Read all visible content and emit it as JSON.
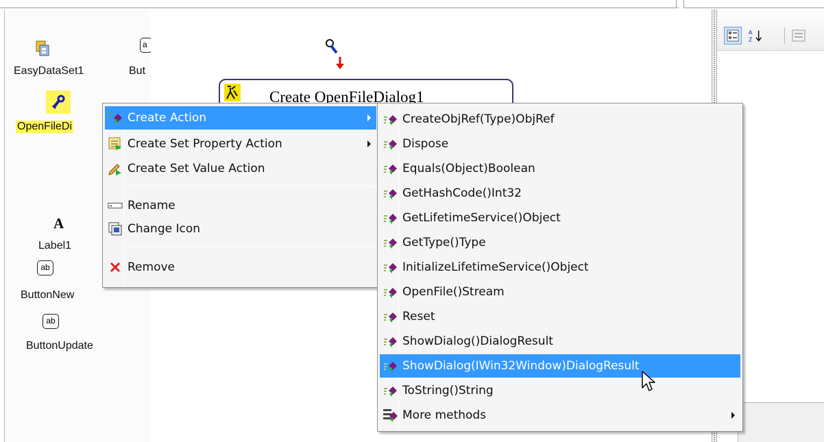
{
  "left_panel": {
    "components": [
      {
        "name": "EasyDataSet1"
      },
      {
        "name": "But"
      },
      {
        "name": "OpenFileDi"
      },
      {
        "name": "Label1"
      },
      {
        "name": "ButtonNew"
      },
      {
        "name": "ButtonUpdate"
      }
    ],
    "icons": {
      "label_glyph": "A",
      "button_glyph": "ab",
      "button_glyph_partial": "a"
    }
  },
  "canvas": {
    "action_title": "Create OpenFileDialog1"
  },
  "properties": {
    "toolbar": [
      {
        "icon": "categorized-icon",
        "active": true
      },
      {
        "icon": "sort-alphabetical-icon",
        "active": false
      },
      {
        "icon": "property-pages-icon",
        "active": false
      }
    ]
  },
  "context_menu": {
    "items": [
      {
        "label": "Create Action",
        "icon": "create-action-icon",
        "submenu": true,
        "selected": true
      },
      {
        "label": "Create Set Property Action",
        "icon": "set-property-icon",
        "submenu": true
      },
      {
        "label": "Create Set Value Action",
        "icon": "set-value-icon",
        "submenu": false
      },
      {
        "label": "Rename",
        "icon": "rename-icon",
        "submenu": false
      },
      {
        "label": "Change Icon",
        "icon": "change-icon-icon",
        "submenu": false
      },
      {
        "label": "Remove",
        "icon": "remove-icon",
        "submenu": false
      }
    ]
  },
  "submenu": {
    "items": [
      {
        "label": "CreateObjRef(Type)ObjRef"
      },
      {
        "label": "Dispose"
      },
      {
        "label": "Equals(Object)Boolean"
      },
      {
        "label": "GetHashCode()Int32"
      },
      {
        "label": "GetLifetimeService()Object"
      },
      {
        "label": "GetType()Type"
      },
      {
        "label": "InitializeLifetimeService()Object"
      },
      {
        "label": "OpenFile()Stream"
      },
      {
        "label": "Reset"
      },
      {
        "label": "ShowDialog()DialogResult"
      },
      {
        "label": "ShowDialog(IWin32Window)DialogResult",
        "selected": true
      },
      {
        "label": "ToString()String"
      },
      {
        "label": "More methods",
        "submenu": true
      }
    ],
    "method_icon": "method-icon",
    "more_icon": "more-methods-icon"
  },
  "colors": {
    "selection": "#3399ff",
    "highlight_label": "#fff55a",
    "action_border": "#3a3a6e",
    "remove_red": "#e02020"
  }
}
